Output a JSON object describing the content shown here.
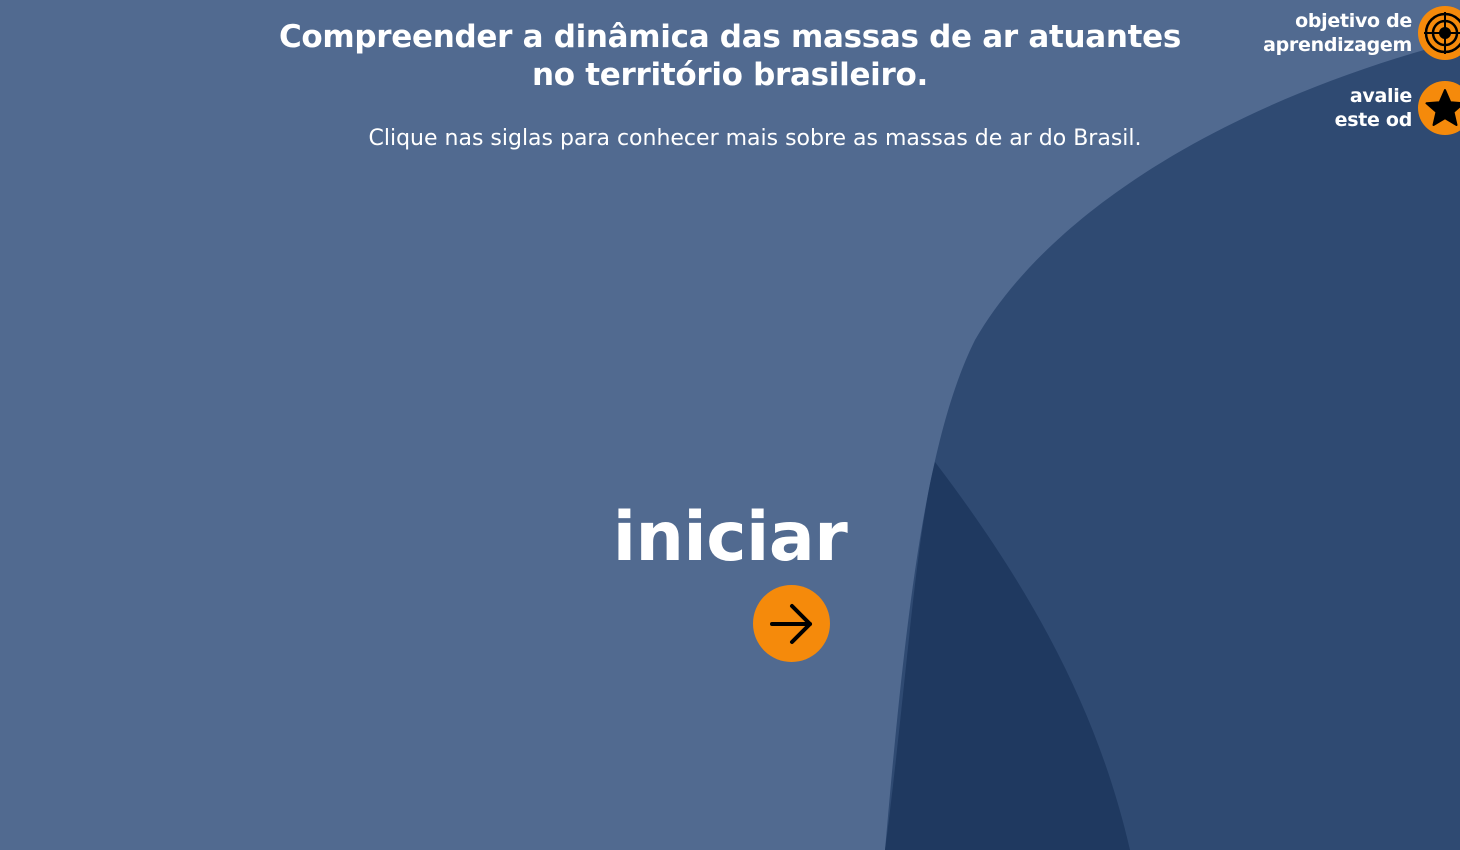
{
  "page": {
    "title": "Compreender a dinâmica das massas de ar atuantes no território brasileiro.",
    "subtitle": "Clique nas siglas para conhecer mais sobre as massas de ar do Brasil."
  },
  "objective_button": {
    "line1": "objetivo de",
    "line2": "aprendizagem",
    "icon": "target-icon"
  },
  "rate_button": {
    "line1": "avalie",
    "line2": "este od",
    "icon": "star-icon"
  },
  "start": {
    "label": "iniciar",
    "icon": "arrow-right-icon"
  },
  "colors": {
    "background": "#516a90",
    "shape_mid": "#2f4a72",
    "shape_dark": "#1f3960",
    "accent": "#f58a0b",
    "text": "#ffffff"
  }
}
